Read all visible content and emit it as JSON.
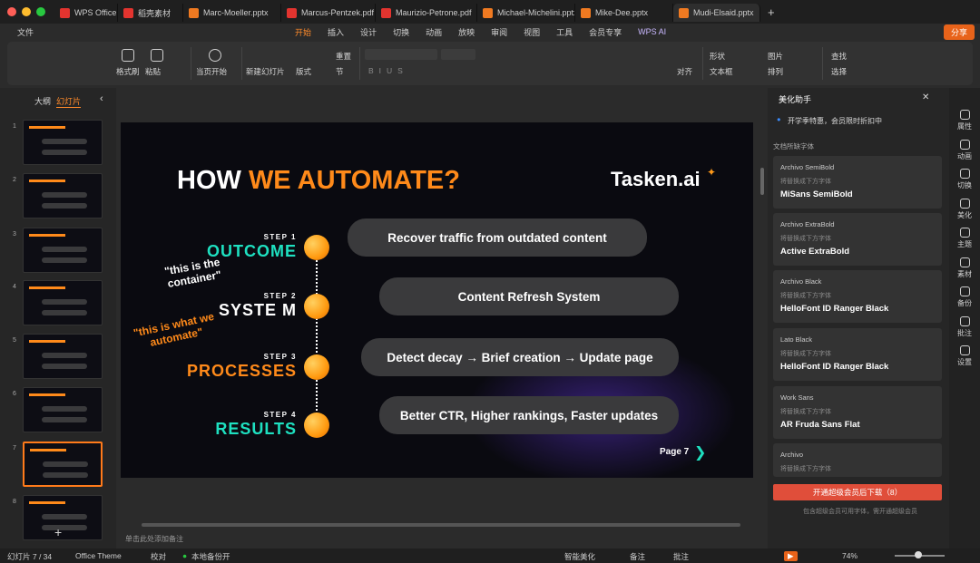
{
  "tabs": [
    {
      "label": "WPS Office",
      "color": "#e3342f"
    },
    {
      "label": "稻壳素材",
      "color": "#e3342f"
    },
    {
      "label": "Marc-Moeller.pptx",
      "color": "#f07a21"
    },
    {
      "label": "Marcus-Pentzek.pdf",
      "color": "#e3342f"
    },
    {
      "label": "Maurizio-Petrone.pdf",
      "color": "#e3342f"
    },
    {
      "label": "Michael-Michelini.pptx",
      "color": "#f07a21"
    },
    {
      "label": "Mike-Dee.pptx",
      "color": "#f07a21"
    },
    {
      "label": "Mudi-Elsaid.pptx",
      "color": "#f07a21"
    }
  ],
  "menus": {
    "file": "文件",
    "items": [
      "开始",
      "插入",
      "设计",
      "切换",
      "动画",
      "放映",
      "审阅",
      "视图",
      "工具",
      "会员专享"
    ],
    "wps_ai": "WPS AI",
    "share": "分享"
  },
  "ribbon": {
    "format_painter": "格式刷",
    "paste": "粘贴",
    "from_current": "当页开始",
    "new_slide": "新建幻灯片",
    "layout": "版式",
    "section": "节",
    "reset": "重置",
    "align": "对齐",
    "shape": "形状",
    "image": "图片",
    "textbox": "文本框",
    "arrange": "排列",
    "find": "查找",
    "select": "选择"
  },
  "left_tabs": {
    "outline": "大纲",
    "slides": "幻灯片"
  },
  "thumbnails": [
    "1",
    "2",
    "3",
    "4",
    "5",
    "6",
    "7",
    "8"
  ],
  "slide": {
    "title_white": "HOW ",
    "title_orange": "WE AUTOMATE?",
    "logo": "Tasken.ai",
    "steps": [
      {
        "label": "STEP 1",
        "word": "OUTCOME",
        "color": "#1ee0c0",
        "text": "Recover traffic from outdated content"
      },
      {
        "label": "STEP 2",
        "word": "SYSTE M",
        "color": "#ffffff",
        "text": "Content Refresh System"
      },
      {
        "label": "STEP 3",
        "word": "PROCESSES",
        "color": "#ff8a1a",
        "text": "Detect decay → Brief creation → Update page"
      },
      {
        "label": "STEP 4",
        "word": "RESULTS",
        "color": "#1ee0c0",
        "text": "Better CTR, Higher rankings, Faster updates"
      }
    ],
    "note1": "\"this is the container\"",
    "note2": "\"this is what we automate\"",
    "page": "Page 7"
  },
  "notes_placeholder": "单击此处添加备注",
  "panel": {
    "title": "美化助手",
    "promo": "开学季特惠，会员限时折扣中",
    "section": "文档所缺字体",
    "fonts": [
      {
        "name": "Archivo SemiBold",
        "sub": "将替换成下方字体",
        "rep": "MiSans SemiBold"
      },
      {
        "name": "Archivo ExtraBold",
        "sub": "将替换成下方字体",
        "rep": "Active ExtraBold"
      },
      {
        "name": "Archivo Black",
        "sub": "将替换成下方字体",
        "rep": "HelloFont ID Ranger Black"
      },
      {
        "name": "Lato Black",
        "sub": "将替换成下方字体",
        "rep": "HelloFont ID Ranger Black"
      },
      {
        "name": "Work Sans",
        "sub": "将替换成下方字体",
        "rep": "AR Fruda Sans Flat"
      },
      {
        "name": "Archivo",
        "sub": "将替换成下方字体",
        "rep": ""
      }
    ],
    "download_btn": "开通超级会员后下载（8）",
    "footnote": "包含超级会员可用字体，需开通超级会员"
  },
  "sidebar": [
    "属性",
    "动画",
    "切换",
    "美化",
    "主题",
    "素材",
    "备份",
    "批注",
    "设置"
  ],
  "status": {
    "slide_count": "幻灯片 7 / 34",
    "theme": "Office Theme",
    "proof": "校对",
    "backup": "本地备份开",
    "smart": "智能美化",
    "notes": "备注",
    "comments": "批注",
    "zoom": "74%"
  }
}
